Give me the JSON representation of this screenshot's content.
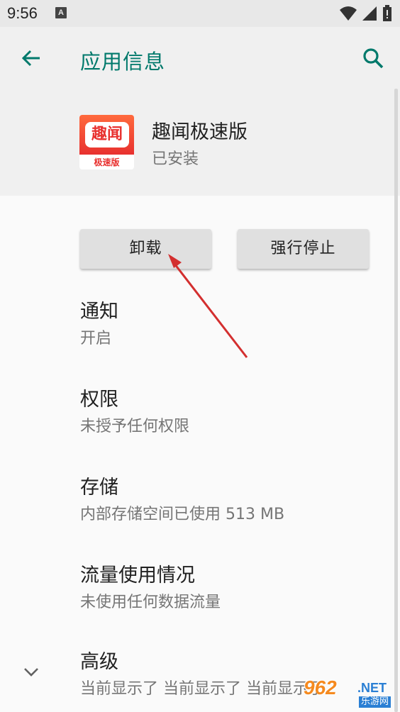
{
  "status_bar": {
    "time": "9:56",
    "notification_icon": "A"
  },
  "header": {
    "title": "应用信息"
  },
  "app": {
    "name": "趣闻极速版",
    "status": "已安装",
    "icon_text": "趣闻",
    "icon_subtext": "极速版"
  },
  "actions": {
    "uninstall_label": "卸载",
    "force_stop_label": "强行停止"
  },
  "prefs": [
    {
      "title": "通知",
      "summary": "开启"
    },
    {
      "title": "权限",
      "summary": "未授予任何权限"
    },
    {
      "title": "存储",
      "summary": "内部存储空间已使用 513 MB"
    },
    {
      "title": "流量使用情况",
      "summary": "未使用任何数据流量"
    },
    {
      "title": "高级",
      "summary": "当前显示了 当前显示了 当前显示了"
    }
  ],
  "watermark": {
    "logo": "962",
    "tld": ".NET",
    "label": "乐游网"
  },
  "colors": {
    "accent": "#00796b",
    "arrow": "#d32f2f"
  }
}
